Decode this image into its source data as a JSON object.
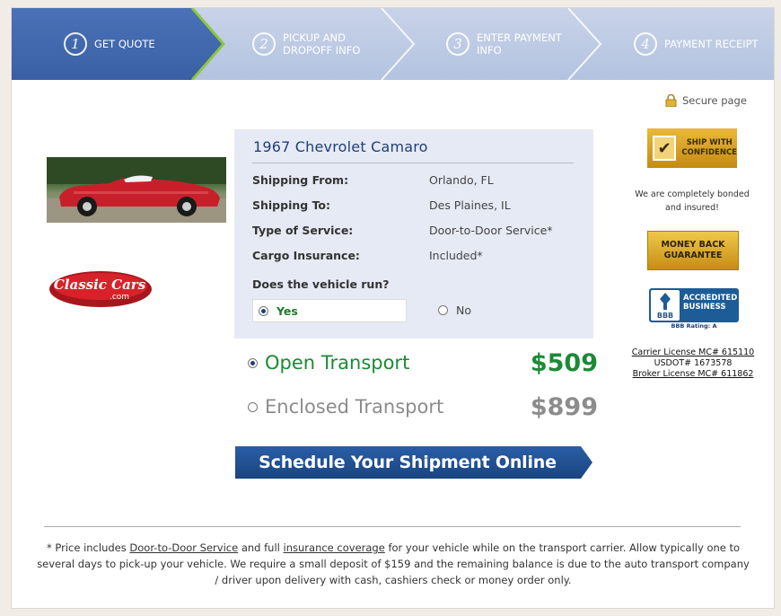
{
  "steps": [
    {
      "num": "1",
      "label": "GET QUOTE",
      "active": true
    },
    {
      "num": "2",
      "label": "PICKUP AND\nDROPOFF INFO",
      "active": false
    },
    {
      "num": "3",
      "label": "ENTER PAYMENT\nINFO",
      "active": false
    },
    {
      "num": "4",
      "label": "PAYMENT RECEIPT",
      "active": false
    }
  ],
  "secure_label": "Secure page",
  "vehicle": {
    "title": "1967 Chevrolet Camaro",
    "details": [
      {
        "label": "Shipping From:",
        "value": "Orlando, FL"
      },
      {
        "label": "Shipping To:",
        "value": "Des Plaines, IL"
      },
      {
        "label": "Type of Service:",
        "value": "Door-to-Door Service*"
      },
      {
        "label": "Cargo Insurance:",
        "value": "Included*"
      }
    ],
    "run_question": "Does the vehicle run?",
    "run_options": {
      "yes": "Yes",
      "no": "No",
      "selected": "yes"
    }
  },
  "transport_options": [
    {
      "name": "Open Transport",
      "price": "$509",
      "selected": true
    },
    {
      "name": "Enclosed Transport",
      "price": "$899",
      "selected": false
    }
  ],
  "schedule_button": "Schedule Your Shipment Online",
  "badges": {
    "ship_with_confidence": "SHIP WITH\nCONFIDENCE",
    "bonded_text": "We are completely bonded\nand insured!",
    "money_back": "MONEY BACK\nGUARANTEE",
    "bbb_text": "ACCREDITED\nBUSINESS",
    "bbb_logo": "BBB",
    "bbb_rating": "BBB Rating: A"
  },
  "licenses": {
    "carrier": "Carrier License MC# 615110",
    "usdot": "USDOT# 1673578",
    "broker": "Broker License MC# 611862"
  },
  "logo_text": {
    "line1": "Classic Cars",
    "line2": ".com"
  },
  "footnote": {
    "p1": "* Price includes ",
    "link1": "Door-to-Door Service",
    "p2": " and full ",
    "link2": "insurance coverage",
    "p3": " for your vehicle while on the transport carrier. Allow typically one to several days to pick-up your vehicle. We require a small deposit of $159 and the remaining balance is due to the auto transport company / driver upon delivery with cash, cashiers check or money order only."
  },
  "colors": {
    "active_step": "#3f66ad",
    "step_bg": "#bccae3",
    "price_open": "#1c8a35",
    "price_enclosed": "#8c8c8c",
    "button": "#1f4d8f"
  }
}
